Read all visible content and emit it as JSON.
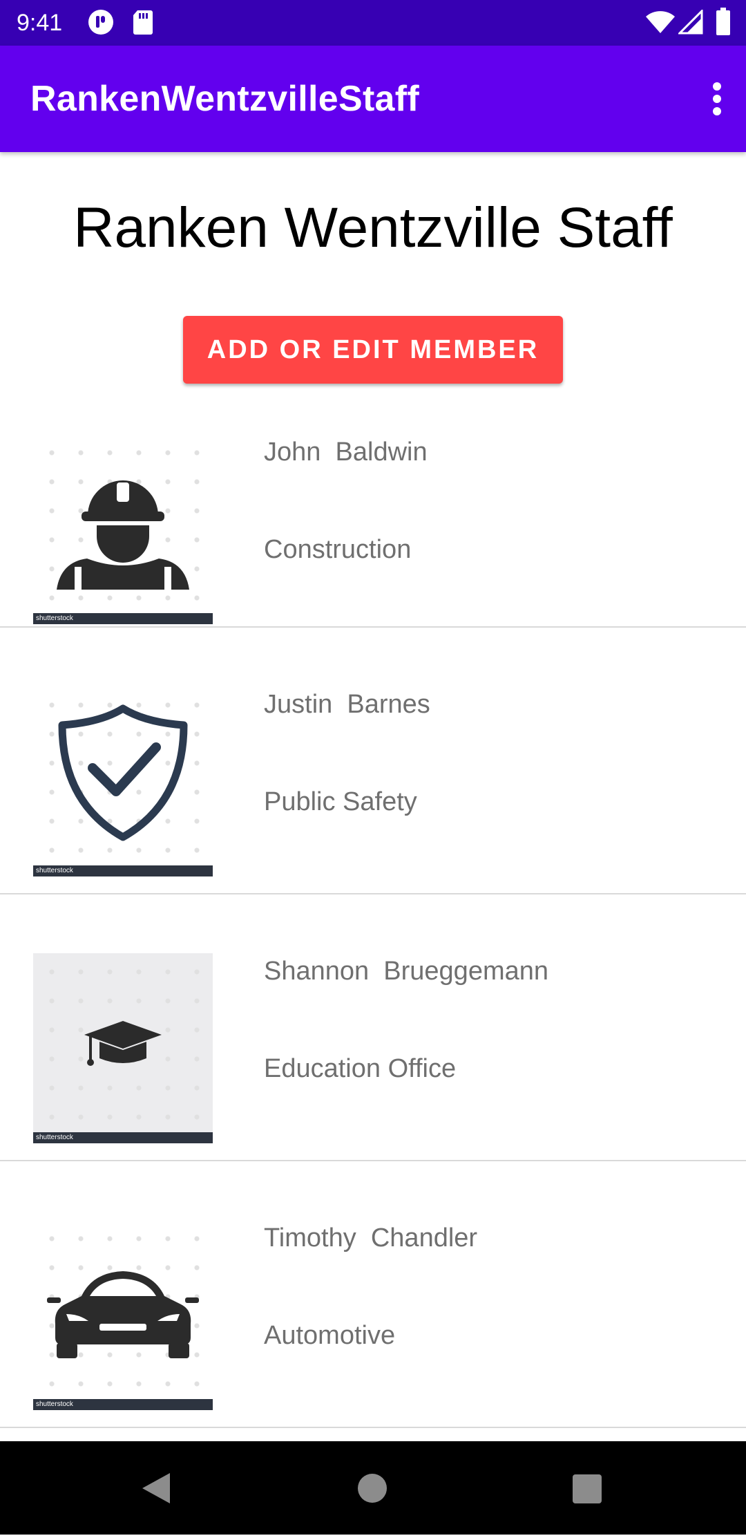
{
  "status_bar": {
    "time": "9:41",
    "icons": [
      "notification-app-icon",
      "sd-card-icon",
      "wifi-icon",
      "cellular-signal-icon",
      "battery-icon"
    ]
  },
  "app_bar": {
    "title": "RankenWentzvilleStaff",
    "menu_icon": "overflow-menu-icon"
  },
  "main": {
    "heading": "Ranken Wentzville Staff",
    "add_button_label": "ADD OR EDIT MEMBER"
  },
  "staff": [
    {
      "first_name": "John",
      "last_name": "Baldwin",
      "department": "Construction",
      "icon": "construction-worker-icon",
      "watermark": "shutterstock"
    },
    {
      "first_name": "Justin",
      "last_name": "Barnes",
      "department": "Public Safety",
      "icon": "shield-check-icon",
      "watermark": "shutterstock"
    },
    {
      "first_name": "Shannon",
      "last_name": "Brueggemann",
      "department": "Education Office",
      "icon": "graduation-cap-icon",
      "watermark": "shutterstock"
    },
    {
      "first_name": "Timothy",
      "last_name": "Chandler",
      "department": "Automotive",
      "icon": "car-icon",
      "watermark": "shutterstock"
    }
  ],
  "nav_bar": {
    "icons": [
      "back-icon",
      "home-icon",
      "recents-icon"
    ]
  },
  "colors": {
    "status_bar": "#3700b3",
    "app_bar": "#6200ee",
    "accent_button": "#ff4545",
    "secondary_text": "#6f6f6f"
  }
}
